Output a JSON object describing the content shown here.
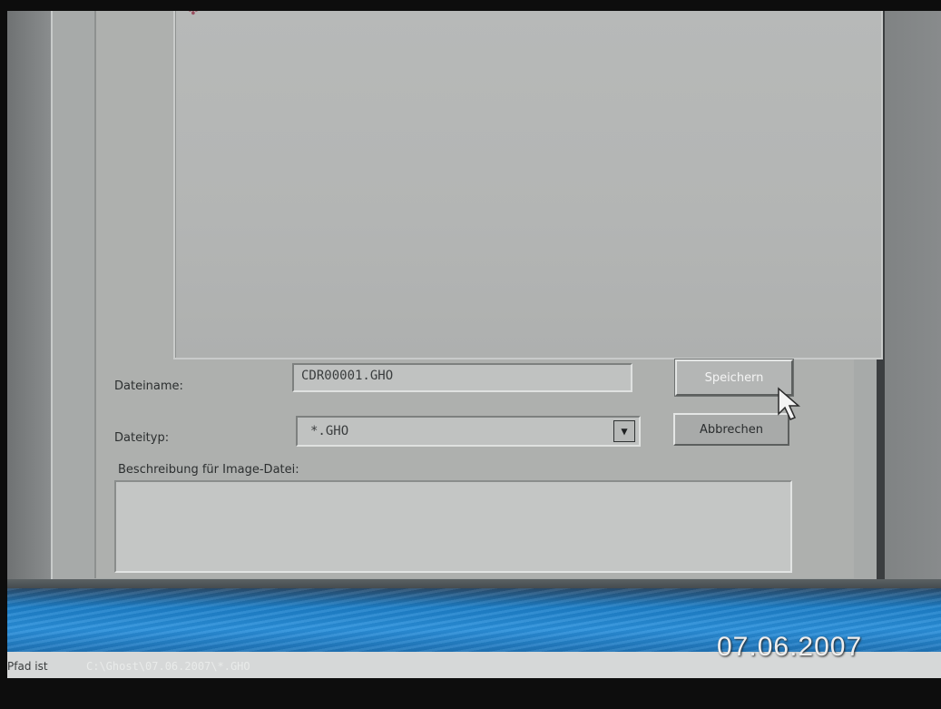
{
  "dialog": {
    "filename_label": "Dateiname:",
    "filename_value": "CDR00001.GHO",
    "filetype_label": "Dateityp:",
    "filetype_value": "*.GHO",
    "description_label": "Beschreibung für Image-Datei:",
    "description_value": "",
    "save_button": "Speichern",
    "cancel_button": "Abbrechen"
  },
  "status_bar": {
    "label": "Pfad ist",
    "path": "C:\\Ghost\\07.06.2007\\*.GHO"
  },
  "photo_date_stamp": "07.06.2007",
  "icons": {
    "file_icon": "file-icon",
    "dropdown": "chevron-down-icon",
    "cursor": "mouse-pointer-icon"
  },
  "colors": {
    "window_gray": "#aeb0ae",
    "blue_band": "#2b90db",
    "status_bar": "#d6d8d8"
  }
}
